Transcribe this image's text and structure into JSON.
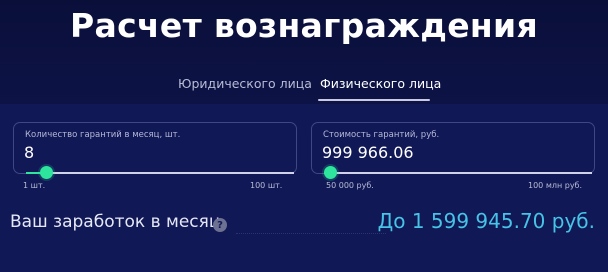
{
  "page_title": "Расчет вознаграждения",
  "tabs": [
    {
      "label": "Юридического лица",
      "active": false
    },
    {
      "label": "Физического лица",
      "active": true
    }
  ],
  "fields": {
    "count": {
      "label": "Количество гарантий в месяц, шт.",
      "value": "8",
      "range_min": "1 шт.",
      "range_max": "100 шт.",
      "slider_fraction": 0.07
    },
    "cost": {
      "label": "Стоимость гарантий, руб.",
      "value": "999 966.06",
      "range_min": "50 000 руб.",
      "range_max": "100 млн руб.",
      "slider_fraction": 0.01
    }
  },
  "earnings": {
    "label": "Ваш заработок в месяц",
    "help_icon_glyph": "?",
    "value": "До 1 599 945.70 руб."
  },
  "colors": {
    "background": "#0c1140",
    "panel": "#111856",
    "accent_green": "#2ee59d",
    "accent_cyan": "#46c3e6"
  }
}
